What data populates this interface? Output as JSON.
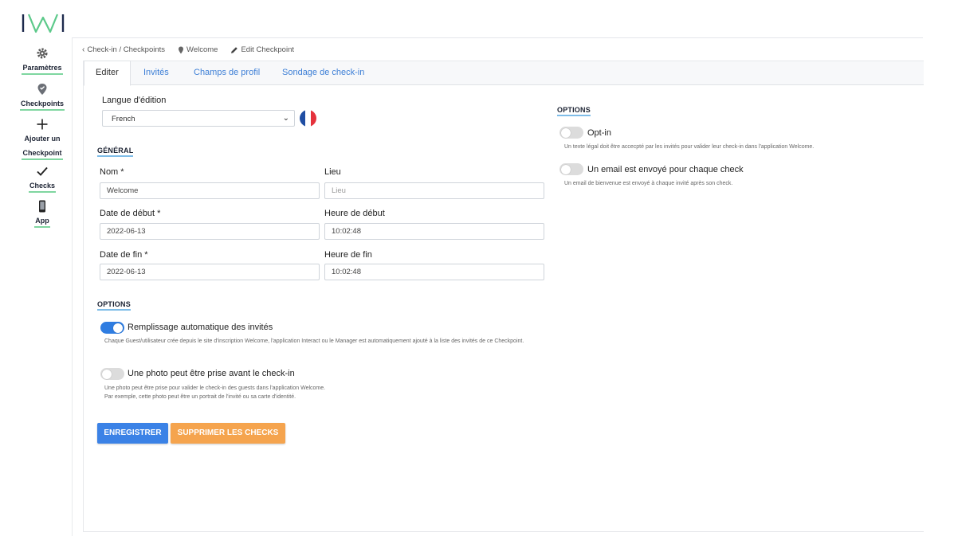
{
  "brand": {
    "logo_text": "IWI"
  },
  "sidebar": {
    "items": [
      {
        "label": "Paramètres",
        "icon": "gear-icon"
      },
      {
        "label": "Checkpoints",
        "icon": "map-pin-icon"
      },
      {
        "label": "Ajouter un Checkpoint",
        "label_line1": "Ajouter un",
        "label_line2": "Checkpoint",
        "icon": "plus-icon"
      },
      {
        "label": "Checks",
        "icon": "checkmark-icon"
      },
      {
        "label": "App",
        "icon": "phone-icon"
      }
    ]
  },
  "breadcrumb": {
    "items": [
      {
        "label": "Check-in / Checkpoints",
        "icon": "chevron-left-icon"
      },
      {
        "label": "Welcome",
        "icon": "map-pin-icon"
      },
      {
        "label": "Edit Checkpoint",
        "icon": "pencil-icon"
      }
    ]
  },
  "tabs": [
    {
      "label": "Editer",
      "active": true
    },
    {
      "label": "Invités",
      "active": false
    },
    {
      "label": "Champs de profil",
      "active": false
    },
    {
      "label": "Sondage de check-in",
      "active": false
    }
  ],
  "form": {
    "language_label": "Langue d'édition",
    "language_value": "French",
    "general_title": "GÉNÉRAL",
    "name_label": "Nom *",
    "name_value": "Welcome",
    "place_label": "Lieu",
    "place_placeholder": "Lieu",
    "start_date_label": "Date de début *",
    "start_date_value": "2022-06-13",
    "start_time_label": "Heure de début",
    "start_time_value": "10:02:48",
    "end_date_label": "Date de fin *",
    "end_date_value": "2022-06-13",
    "end_time_label": "Heure de fin",
    "end_time_value": "10:02:48",
    "options_title": "OPTIONS",
    "autofill_label": "Remplissage automatique des invités",
    "autofill_on": true,
    "autofill_help": "Chaque Guest/utilisateur crée depuis le site d'inscription Welcome, l'application Interact ou le Manager est automatiquement ajouté à la liste des invités de ce Checkpoint.",
    "photo_label": "Une photo peut être prise avant le check-in",
    "photo_on": false,
    "photo_help_1": "Une photo peut être prise pour valider le check-in des guests dans l'application Welcome.",
    "photo_help_2": "Par exemple, cette photo peut être un portrait de l'invité ou sa carte d'identité."
  },
  "right_options": {
    "title": "OPTIONS",
    "optin_label": "Opt-in",
    "optin_on": false,
    "optin_help": "Un texte légal doit être accecpté par les invités pour valider leur check-in dans l'application Welcome.",
    "email_label": "Un email est envoyé pour chaque check",
    "email_on": false,
    "email_help": "Un email de bienvenue est envoyé à chaque invité après son check."
  },
  "actions": {
    "save_label": "ENREGISTRER",
    "delete_label": "SUPPRIMER LES CHECKS"
  },
  "colors": {
    "accent": "#3b82e6",
    "warning": "#f5a44e",
    "logo_green": "#5cc98a",
    "logo_navy": "#1d2a4d",
    "flag_blue": "#1f4ea3",
    "flag_red": "#e5323c"
  }
}
